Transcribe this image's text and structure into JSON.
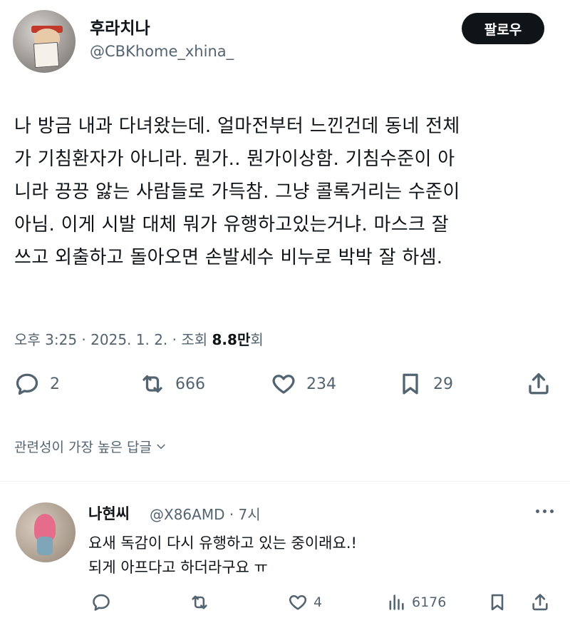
{
  "author": {
    "display_name": "후라치나",
    "handle": "@CBKhome_xhina_",
    "follow_label": "팔로우"
  },
  "tweet": {
    "text": "나 방금 내과 다녀왔는데. 얼마전부터 느낀건데 동네 전체\n가 기침환자가 아니라. 뭔가.. 뭔가이상함. 기침수준이 아\n니라 끙끙 앓는 사람들로 가득참. 그냥 콜록거리는 수준이\n아님. 이게 시발 대체 뭐가 유행하고있는거냐. 마스크 잘\n쓰고 외출하고 돌아오면 손발세수 비누로 박박 잘 하셈.",
    "meta_time": "오후 3:25 · 2025. 1. 2. · 조회 ",
    "views": "8.8만",
    "views_suffix": "회"
  },
  "actions": {
    "replies": "2",
    "reposts": "666",
    "likes": "234",
    "bookmarks": "29"
  },
  "replies_sort": {
    "label": "관련성이 가장 높은 답글"
  },
  "reply": {
    "name": "나현씨",
    "handle_time": "@X86AMD · 7시",
    "text": "요새 독감이 다시 유행하고 있는 중이래요.!\n되게 아프다고 하더라구요 ㅠ",
    "likes": "4",
    "views": "6176"
  },
  "icons": {
    "reply": "reply-icon",
    "repost": "repost-icon",
    "like": "heart-icon",
    "bookmark": "bookmark-icon",
    "share": "share-icon",
    "views": "views-icon",
    "more": "more-icon",
    "chevron": "chevron-down-icon"
  },
  "colors": {
    "text": "#0f1419",
    "secondary": "#536471",
    "follow_bg": "#0f1419"
  }
}
